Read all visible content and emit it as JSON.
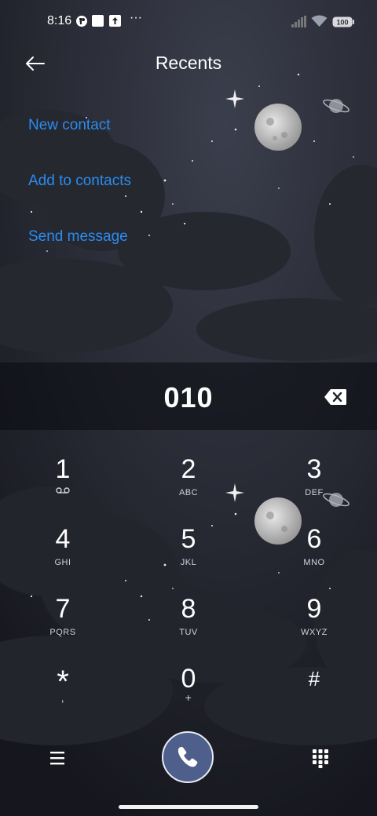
{
  "status_bar": {
    "time": "8:16",
    "more": "···",
    "battery": "100"
  },
  "header": {
    "title": "Recents"
  },
  "actions": [
    {
      "label": "New contact"
    },
    {
      "label": "Add to contacts"
    },
    {
      "label": "Send message"
    }
  ],
  "dial": {
    "number": "010"
  },
  "keypad": [
    {
      "digit": "1",
      "sub": ""
    },
    {
      "digit": "2",
      "sub": "ABC"
    },
    {
      "digit": "3",
      "sub": "DEF"
    },
    {
      "digit": "4",
      "sub": "GHI"
    },
    {
      "digit": "5",
      "sub": "JKL"
    },
    {
      "digit": "6",
      "sub": "MNO"
    },
    {
      "digit": "7",
      "sub": "PQRS"
    },
    {
      "digit": "8",
      "sub": "TUV"
    },
    {
      "digit": "9",
      "sub": "WXYZ"
    },
    {
      "digit": "*",
      "sub": ","
    },
    {
      "digit": "0",
      "sub": "+"
    },
    {
      "digit": "#",
      "sub": ""
    }
  ],
  "icons": {
    "back": "arrow-left-icon",
    "backspace": "backspace-icon",
    "voicemail": "voicemail-icon",
    "menu": "menu-icon",
    "call": "phone-icon",
    "dialpad": "dialpad-icon"
  },
  "colors": {
    "accent": "#2a8cf0",
    "call_button": "#4f5f8c",
    "background": "#1c1e26"
  }
}
